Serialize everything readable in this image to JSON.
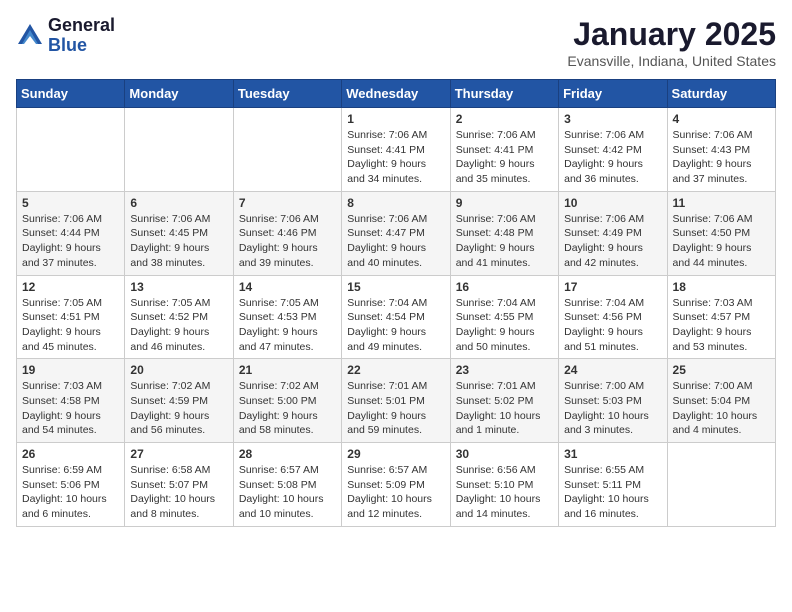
{
  "header": {
    "logo_general": "General",
    "logo_blue": "Blue",
    "month_title": "January 2025",
    "location": "Evansville, Indiana, United States"
  },
  "days_of_week": [
    "Sunday",
    "Monday",
    "Tuesday",
    "Wednesday",
    "Thursday",
    "Friday",
    "Saturday"
  ],
  "weeks": [
    [
      {
        "day": "",
        "info": ""
      },
      {
        "day": "",
        "info": ""
      },
      {
        "day": "",
        "info": ""
      },
      {
        "day": "1",
        "info": "Sunrise: 7:06 AM\nSunset: 4:41 PM\nDaylight: 9 hours\nand 34 minutes."
      },
      {
        "day": "2",
        "info": "Sunrise: 7:06 AM\nSunset: 4:41 PM\nDaylight: 9 hours\nand 35 minutes."
      },
      {
        "day": "3",
        "info": "Sunrise: 7:06 AM\nSunset: 4:42 PM\nDaylight: 9 hours\nand 36 minutes."
      },
      {
        "day": "4",
        "info": "Sunrise: 7:06 AM\nSunset: 4:43 PM\nDaylight: 9 hours\nand 37 minutes."
      }
    ],
    [
      {
        "day": "5",
        "info": "Sunrise: 7:06 AM\nSunset: 4:44 PM\nDaylight: 9 hours\nand 37 minutes."
      },
      {
        "day": "6",
        "info": "Sunrise: 7:06 AM\nSunset: 4:45 PM\nDaylight: 9 hours\nand 38 minutes."
      },
      {
        "day": "7",
        "info": "Sunrise: 7:06 AM\nSunset: 4:46 PM\nDaylight: 9 hours\nand 39 minutes."
      },
      {
        "day": "8",
        "info": "Sunrise: 7:06 AM\nSunset: 4:47 PM\nDaylight: 9 hours\nand 40 minutes."
      },
      {
        "day": "9",
        "info": "Sunrise: 7:06 AM\nSunset: 4:48 PM\nDaylight: 9 hours\nand 41 minutes."
      },
      {
        "day": "10",
        "info": "Sunrise: 7:06 AM\nSunset: 4:49 PM\nDaylight: 9 hours\nand 42 minutes."
      },
      {
        "day": "11",
        "info": "Sunrise: 7:06 AM\nSunset: 4:50 PM\nDaylight: 9 hours\nand 44 minutes."
      }
    ],
    [
      {
        "day": "12",
        "info": "Sunrise: 7:05 AM\nSunset: 4:51 PM\nDaylight: 9 hours\nand 45 minutes."
      },
      {
        "day": "13",
        "info": "Sunrise: 7:05 AM\nSunset: 4:52 PM\nDaylight: 9 hours\nand 46 minutes."
      },
      {
        "day": "14",
        "info": "Sunrise: 7:05 AM\nSunset: 4:53 PM\nDaylight: 9 hours\nand 47 minutes."
      },
      {
        "day": "15",
        "info": "Sunrise: 7:04 AM\nSunset: 4:54 PM\nDaylight: 9 hours\nand 49 minutes."
      },
      {
        "day": "16",
        "info": "Sunrise: 7:04 AM\nSunset: 4:55 PM\nDaylight: 9 hours\nand 50 minutes."
      },
      {
        "day": "17",
        "info": "Sunrise: 7:04 AM\nSunset: 4:56 PM\nDaylight: 9 hours\nand 51 minutes."
      },
      {
        "day": "18",
        "info": "Sunrise: 7:03 AM\nSunset: 4:57 PM\nDaylight: 9 hours\nand 53 minutes."
      }
    ],
    [
      {
        "day": "19",
        "info": "Sunrise: 7:03 AM\nSunset: 4:58 PM\nDaylight: 9 hours\nand 54 minutes."
      },
      {
        "day": "20",
        "info": "Sunrise: 7:02 AM\nSunset: 4:59 PM\nDaylight: 9 hours\nand 56 minutes."
      },
      {
        "day": "21",
        "info": "Sunrise: 7:02 AM\nSunset: 5:00 PM\nDaylight: 9 hours\nand 58 minutes."
      },
      {
        "day": "22",
        "info": "Sunrise: 7:01 AM\nSunset: 5:01 PM\nDaylight: 9 hours\nand 59 minutes."
      },
      {
        "day": "23",
        "info": "Sunrise: 7:01 AM\nSunset: 5:02 PM\nDaylight: 10 hours\nand 1 minute."
      },
      {
        "day": "24",
        "info": "Sunrise: 7:00 AM\nSunset: 5:03 PM\nDaylight: 10 hours\nand 3 minutes."
      },
      {
        "day": "25",
        "info": "Sunrise: 7:00 AM\nSunset: 5:04 PM\nDaylight: 10 hours\nand 4 minutes."
      }
    ],
    [
      {
        "day": "26",
        "info": "Sunrise: 6:59 AM\nSunset: 5:06 PM\nDaylight: 10 hours\nand 6 minutes."
      },
      {
        "day": "27",
        "info": "Sunrise: 6:58 AM\nSunset: 5:07 PM\nDaylight: 10 hours\nand 8 minutes."
      },
      {
        "day": "28",
        "info": "Sunrise: 6:57 AM\nSunset: 5:08 PM\nDaylight: 10 hours\nand 10 minutes."
      },
      {
        "day": "29",
        "info": "Sunrise: 6:57 AM\nSunset: 5:09 PM\nDaylight: 10 hours\nand 12 minutes."
      },
      {
        "day": "30",
        "info": "Sunrise: 6:56 AM\nSunset: 5:10 PM\nDaylight: 10 hours\nand 14 minutes."
      },
      {
        "day": "31",
        "info": "Sunrise: 6:55 AM\nSunset: 5:11 PM\nDaylight: 10 hours\nand 16 minutes."
      },
      {
        "day": "",
        "info": ""
      }
    ]
  ]
}
